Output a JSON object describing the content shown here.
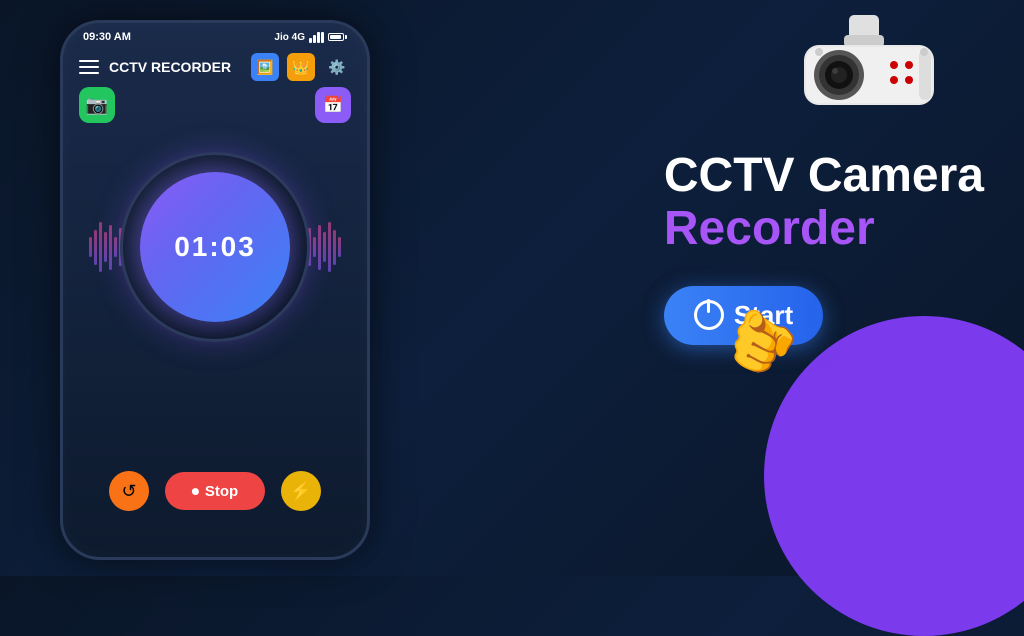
{
  "background": {
    "gradient_start": "#0a1628",
    "gradient_end": "#0d1f3c"
  },
  "phone": {
    "status_bar": {
      "time": "09:30 AM",
      "carrier": "Jio 4G"
    },
    "header": {
      "title": "CCTV RECORDER",
      "hamburger_label": "menu",
      "icon_gallery": "🖼️",
      "icon_crown": "👑",
      "icon_settings": "⚙️"
    },
    "float_buttons": {
      "left_icon": "📷",
      "right_icon": "📅"
    },
    "timer": {
      "display": "01:03"
    },
    "controls": {
      "refresh_icon": "↺",
      "stop_label": "Stop",
      "stop_icon": "⏺",
      "flash_icon": "⚡"
    }
  },
  "right_panel": {
    "title_line1": "CCTV Camera",
    "title_line2": "Recorder",
    "start_button_label": "Start",
    "power_icon_label": "power"
  }
}
